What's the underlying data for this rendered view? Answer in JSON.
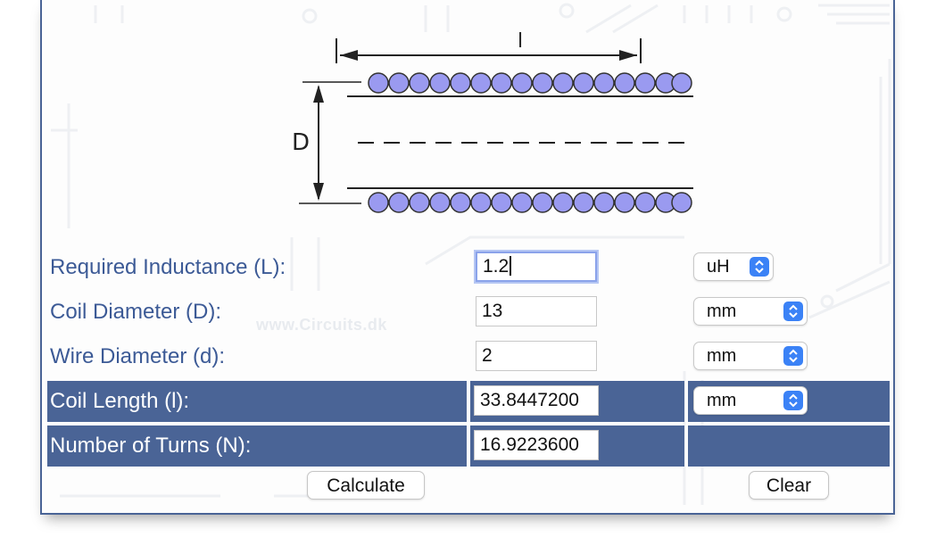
{
  "diagram": {
    "length_symbol": "l",
    "diameter_symbol": "D"
  },
  "watermark": "www.Circuits.dk",
  "fields": {
    "inductance": {
      "label": "Required Inductance (L):",
      "value": "1.2",
      "unit": "uH"
    },
    "coil_diameter": {
      "label": "Coil Diameter (D):",
      "value": "13",
      "unit": "mm"
    },
    "wire_diameter": {
      "label": "Wire Diameter (d):",
      "value": "2",
      "unit": "mm"
    },
    "coil_length": {
      "label": "Coil Length (l):",
      "value": "33.8447200",
      "unit": "mm"
    },
    "turns": {
      "label": "Number of Turns (N):",
      "value": "16.9223600"
    }
  },
  "buttons": {
    "calculate": "Calculate",
    "clear": "Clear"
  },
  "colors": {
    "header_bg": "#4a6496",
    "label_text": "#3c5a96",
    "coil_wire": "#9a9af0",
    "select_arrow": "#3b82f6",
    "focus_ring": "#8aa2ea"
  },
  "icons": {
    "select_arrow": "chevron-up-down-icon"
  }
}
